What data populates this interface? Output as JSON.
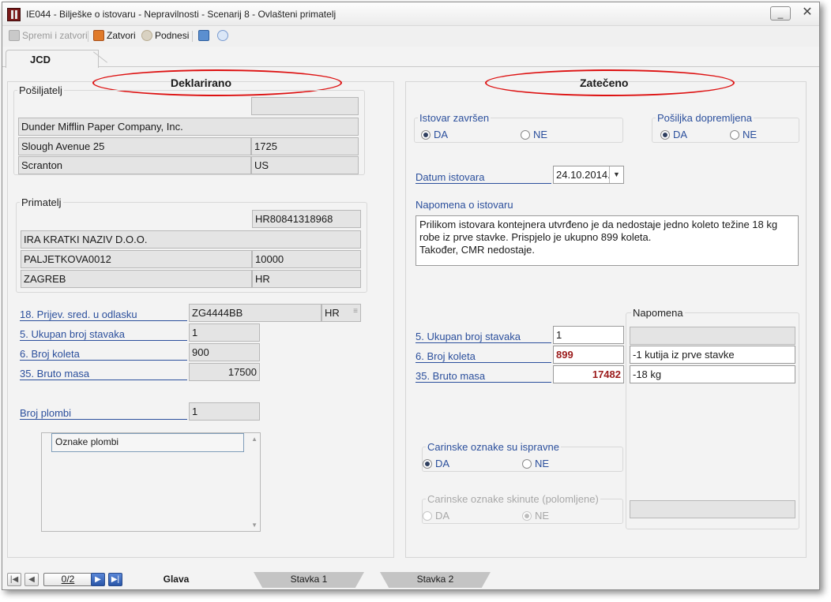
{
  "window": {
    "title": "IE044 - Bilješke o istovaru - Nepravilnosti - Scenarij 8 - Ovlašteni primatelj",
    "minimize_label": "_",
    "close_label": "✕"
  },
  "toolbar": {
    "save_close_label": "Spremi i zatvori",
    "close_label": "Zatvori",
    "submit_label": "Podnesi"
  },
  "top_tab": {
    "label": "JCD"
  },
  "declared": {
    "heading": "Deklarirano",
    "sender": {
      "legend": "Pošiljatelj",
      "top_field": "",
      "name": "Dunder Mifflin Paper Company, Inc.",
      "street": "Slough Avenue 25",
      "postcode": "1725",
      "city": "Scranton",
      "country": "US"
    },
    "recipient": {
      "legend": "Primatelj",
      "id": "HR80841318968",
      "name": "IRA KRATKI NAZIV D.O.O.",
      "street": "PALJETKOVA0012",
      "postcode": "10000",
      "city": "ZAGREB",
      "country": "HR"
    },
    "transport_label": "18. Prijev. sred. u odlasku",
    "transport_value": "ZG4444BB",
    "transport_country": "HR",
    "items_label": "5. Ukupan broj stavaka",
    "items_value": "1",
    "packages_label": "6. Broj koleta",
    "packages_value": "900",
    "mass_label": "35. Bruto masa",
    "mass_value": "17500",
    "seals_label": "Broj plombi",
    "seals_value": "1",
    "seals_list_header": "Oznake plombi"
  },
  "found": {
    "heading": "Zatečeno",
    "unloading_done": {
      "legend": "Istovar završen",
      "yes": "DA",
      "no": "NE",
      "selected": "DA"
    },
    "shipment_delivered": {
      "legend": "Pošiljka dopremljena",
      "yes": "DA",
      "no": "NE",
      "selected": "DA"
    },
    "date_label": "Datum istovara",
    "date_value": "24.10.2014.",
    "note_label": "Napomena o istovaru",
    "note_lines": [
      "Prilikom istovara kontejnera utvrđeno je da nedostaje jedno koleto težine 18 kg",
      "robe iz prve stavke. Prispjelo je ukupno 899 koleta.",
      "Također, CMR nedostaje."
    ],
    "remarks_legend": "Napomena",
    "items_label": "5. Ukupan broj stavaka",
    "items_value": "1",
    "items_remark": "",
    "packages_label": "6. Broj koleta",
    "packages_value": "899",
    "packages_remark": "-1 kutija iz prve stavke",
    "mass_label": "35. Bruto masa",
    "mass_value": "17482",
    "mass_remark": "-18 kg",
    "seals_correct": {
      "legend": "Carinske oznake su ispravne",
      "yes": "DA",
      "no": "NE",
      "selected": "DA"
    },
    "seals_removed": {
      "legend": "Carinske oznake skinute (polomljene)",
      "yes": "DA",
      "no": "NE",
      "selected": "NE"
    },
    "seals_removed_remark": ""
  },
  "bottom_nav": {
    "page": "0/2",
    "tabs": [
      "Glava",
      "Stavka 1",
      "Stavka 2"
    ]
  }
}
